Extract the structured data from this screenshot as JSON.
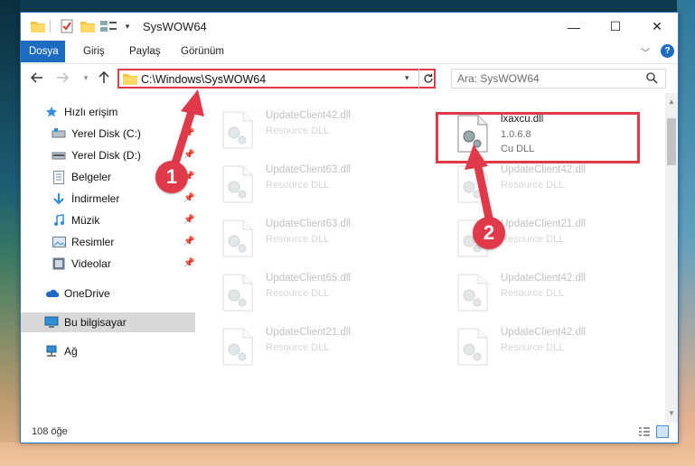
{
  "window": {
    "title": "SysWOW64",
    "controls": {
      "minimize": "—",
      "maximize": "☐",
      "close": "✕"
    }
  },
  "ribbon": {
    "tabs": [
      "Dosya",
      "Giriş",
      "Paylaş",
      "Görünüm"
    ],
    "help": "?"
  },
  "address": {
    "path": "C:\\Windows\\SysWOW64"
  },
  "search": {
    "placeholder": "Ara: SysWOW64"
  },
  "sidebar": {
    "items": [
      {
        "label": "Hızlı erişim",
        "icon": "star-icon",
        "pinned": false
      },
      {
        "label": "Yerel Disk (C:)",
        "icon": "drive-icon",
        "pinned": true
      },
      {
        "label": "Yerel Disk (D:)",
        "icon": "drive-icon",
        "pinned": true
      },
      {
        "label": "Belgeler",
        "icon": "document-icon",
        "pinned": true
      },
      {
        "label": "İndirmeler",
        "icon": "download-icon",
        "pinned": true
      },
      {
        "label": "Müzik",
        "icon": "music-icon",
        "pinned": true
      },
      {
        "label": "Resimler",
        "icon": "pictures-icon",
        "pinned": true
      },
      {
        "label": "Videolar",
        "icon": "video-icon",
        "pinned": true
      },
      {
        "label": "OneDrive",
        "icon": "cloud-icon",
        "pinned": false
      },
      {
        "label": "Bu bilgisayar",
        "icon": "computer-icon",
        "pinned": false
      },
      {
        "label": "Ağ",
        "icon": "network-icon",
        "pinned": false
      }
    ]
  },
  "files": [
    {
      "name": "UpdateClient42.dll",
      "line2": "Resource DLL",
      "line3": ""
    },
    {
      "name": "lxaxcu.dll",
      "line2": "1.0.6.8",
      "line3": "Cu DLL"
    },
    {
      "name": "UpdateClient63.dll",
      "line2": "Resource DLL",
      "line3": ""
    },
    {
      "name": "UpdateClient42.dll",
      "line2": "Resource DLL",
      "line3": ""
    },
    {
      "name": "UpdateClient63.dll",
      "line2": "Resource DLL",
      "line3": ""
    },
    {
      "name": "UpdateClient21.dll",
      "line2": "Resource DLL",
      "line3": ""
    },
    {
      "name": "UpdateClient65.dll",
      "line2": "Resource DLL",
      "line3": ""
    },
    {
      "name": "UpdateClient42.dll",
      "line2": "Resource DLL",
      "line3": ""
    },
    {
      "name": "UpdateClient21.dll",
      "line2": "Resource DLL",
      "line3": ""
    },
    {
      "name": "UpdateClient42.dll",
      "line2": "Resource DLL",
      "line3": ""
    }
  ],
  "status": {
    "count": "108 öğe"
  },
  "annotations": {
    "step1": "1",
    "step2": "2",
    "color": "#e0394a"
  },
  "colors": {
    "accent": "#1e6cc2",
    "highlight": "#e0394a"
  }
}
